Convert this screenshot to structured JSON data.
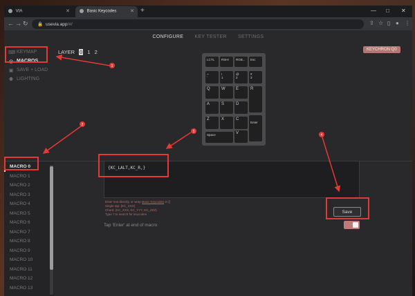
{
  "browser": {
    "tabs": [
      {
        "title": "VIA",
        "active": false
      },
      {
        "title": "Basic Keycodes",
        "active": true
      }
    ],
    "new_tab_glyph": "+",
    "url_host": "usevia.app",
    "url_path": "/#/",
    "window_controls": {
      "minimize": "—",
      "maximize": "□",
      "close": "✕"
    }
  },
  "app": {
    "top_nav": [
      {
        "label": "CONFIGURE",
        "active": true
      },
      {
        "label": "KEY TESTER",
        "active": false
      },
      {
        "label": "SETTINGS",
        "active": false
      }
    ],
    "layer": {
      "label": "LAYER",
      "options": [
        "0",
        "1",
        "2"
      ],
      "selected": "0"
    },
    "keyboard_name": "KEYCHRON Q0",
    "left_nav": [
      {
        "label": "KEYMAP",
        "icon": "keyboard-icon",
        "glyph": "⌨",
        "active": false
      },
      {
        "label": "MACROS",
        "icon": "macro-icon",
        "glyph": "◎",
        "active": true
      },
      {
        "label": "SAVE + LOAD",
        "icon": "save-icon",
        "glyph": "▣",
        "active": false
      },
      {
        "label": "LIGHTING",
        "icon": "bulb-icon",
        "glyph": "⚉",
        "active": false
      }
    ],
    "keypad": [
      {
        "label": "LCTL"
      },
      {
        "label": "RSHI"
      },
      {
        "label": "RGB..."
      },
      {
        "label": "Esc"
      },
      {
        "label": "~\n`"
      },
      {
        "label": "!\n1"
      },
      {
        "label": "@\n2"
      },
      {
        "label": "#\n3"
      },
      {
        "label": "Q"
      },
      {
        "label": "W"
      },
      {
        "label": "E"
      },
      {
        "label": "R"
      },
      {
        "label": "A"
      },
      {
        "label": "S"
      },
      {
        "label": "D"
      },
      {
        "label": "Z"
      },
      {
        "label": "X"
      },
      {
        "label": "C"
      },
      {
        "label": "Enter"
      },
      {
        "label": "Space"
      },
      {
        "label": "V"
      }
    ],
    "macros": [
      "MACRO 0",
      "MACRO 1",
      "MACRO 2",
      "MACRO 3",
      "MACRO 4",
      "MACRO 5",
      "MACRO 6",
      "MACRO 7",
      "MACRO 8",
      "MACRO 9",
      "MACRO 10",
      "MACRO 11",
      "MACRO 12",
      "MACRO 13"
    ],
    "selected_macro": "MACRO 0",
    "macro_text": "{KC_LALT,KC_R,}",
    "hints": {
      "line1_prefix": "Enter text directly, or wrap ",
      "line1_link": "Basic Keycodes",
      "line1_suffix": " in {}",
      "line2": "Single tap: {KC_XXX}",
      "line3": "Chord: {KC_XXX, KC_YYY, KC_ZZZ}",
      "line4": "Type ? to search for keycodes"
    },
    "save_label": "Save",
    "tap_enter_label": "Tap 'Enter' at end of macro",
    "tap_enter_on": true
  },
  "annotations": [
    {
      "number": "1"
    },
    {
      "number": "2"
    },
    {
      "number": "3"
    },
    {
      "number": "4"
    }
  ],
  "colors": {
    "accent": "#b87473",
    "annotation": "#e53935",
    "bg": "#29292b"
  }
}
